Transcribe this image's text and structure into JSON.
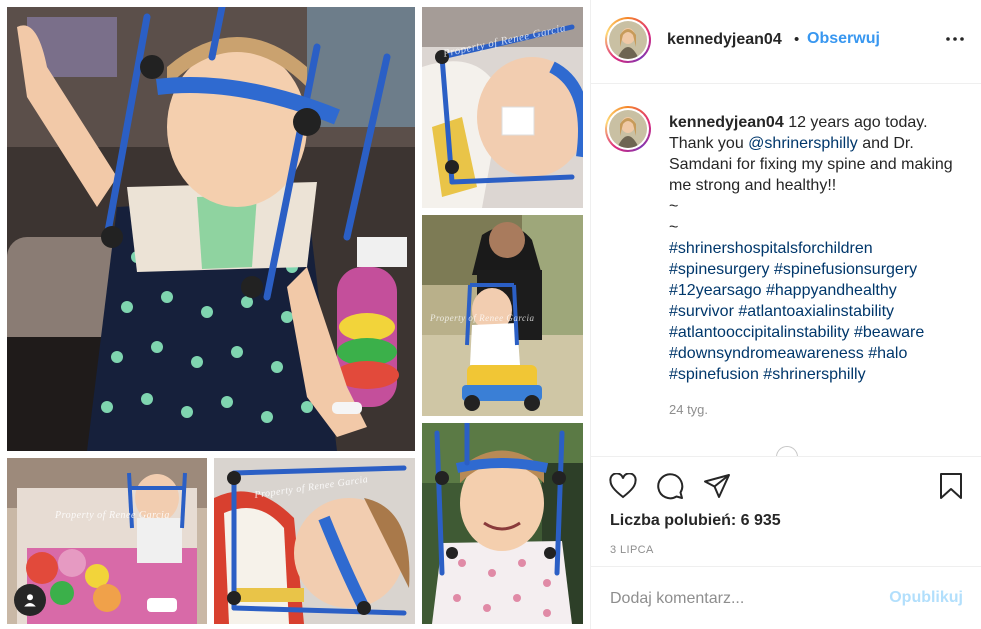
{
  "header": {
    "username": "kennedyjean04",
    "separator": "•",
    "follow_label": "Obserwuj",
    "more_icon": "more-horizontal-icon"
  },
  "caption": {
    "username": "kennedyjean04",
    "text_line1": "12 years ago today.",
    "text_thank": "Thank you",
    "mention": "@shrinersphilly",
    "text_after_mention": "and Dr. Samdani for fixing my spine and making me strong and healthy!!",
    "tilde1": "~",
    "tilde2": "~",
    "hashtags": [
      "#shrinershospitalsforchildren",
      "#spinesurgery",
      "#spinefusionsurgery",
      "#12yearsago",
      "#happyandhealthy",
      "#survivor",
      "#atlantoaxialinstability",
      "#atlantooccipitalinstability",
      "#beaware",
      "#downsyndromeawareness",
      "#halo",
      "#spinefusion",
      "#shrinersphilly"
    ],
    "time_ago": "24 tyg."
  },
  "actions": {
    "icons": [
      "heart-icon",
      "comment-icon",
      "share-icon",
      "bookmark-icon"
    ],
    "likes_label": "Liczba polubień: 6 935",
    "date_label": "3 LIPCA"
  },
  "comment_box": {
    "placeholder": "Dodaj komentarz...",
    "publish_label": "Opublikuj"
  },
  "watermark": "Property of Renee Garcia",
  "colors": {
    "link_blue": "#3897f0",
    "hashtag_blue": "#00376b",
    "publish_disabled": "#b2dffc",
    "muted_gray": "#8e8e8e",
    "halo_blue": "#3565b5"
  }
}
